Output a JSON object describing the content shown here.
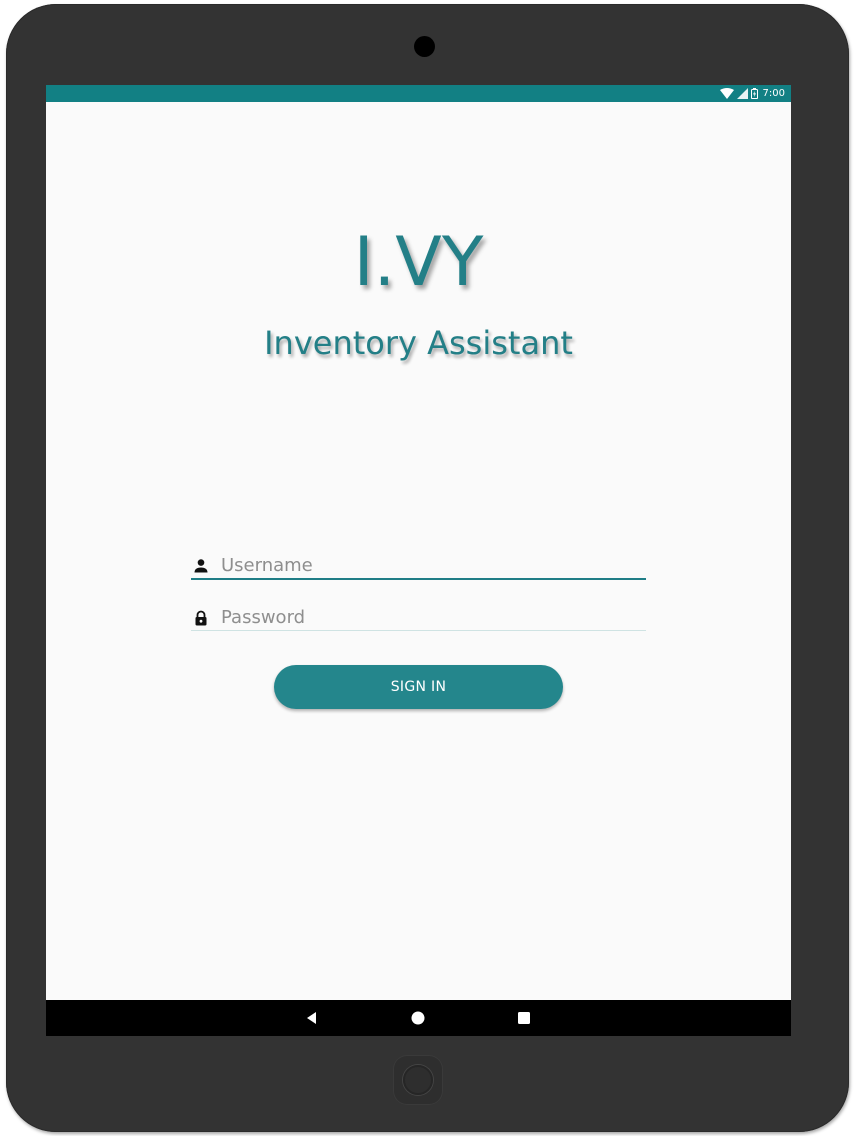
{
  "status_bar": {
    "time": "7:00",
    "icons": [
      "wifi-icon",
      "signal-icon",
      "battery-icon"
    ],
    "color": "#128084"
  },
  "app": {
    "title": "I.VY",
    "subtitle": "Inventory Assistant",
    "accent_color": "#237f87"
  },
  "login": {
    "username": {
      "placeholder": "Username",
      "value": "",
      "icon": "person-icon"
    },
    "password": {
      "placeholder": "Password",
      "value": "",
      "icon": "lock-icon"
    },
    "sign_in_label": "SIGN IN"
  },
  "nav_bar": {
    "buttons": [
      "back-icon",
      "home-icon",
      "recents-icon"
    ]
  }
}
